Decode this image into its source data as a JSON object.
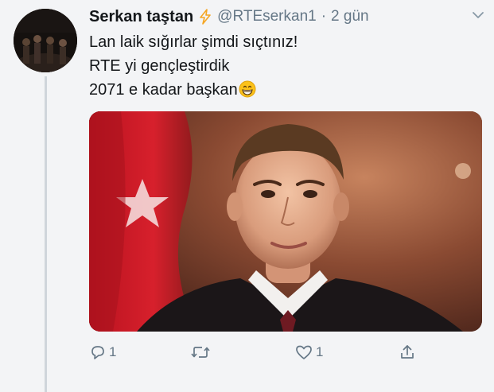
{
  "tweet": {
    "display_name": "Serkan taştan",
    "handle": "@RTEserkan1",
    "separator": "·",
    "time": "2 gün",
    "lines": [
      "Lan laik sığırlar şimdi sıçtınız!",
      "RTE yi gençleştirdik",
      "2071 e kadar başkan"
    ],
    "emoji": "grinning-face-emoji"
  },
  "actions": {
    "reply_count": "1",
    "retweet_count": "",
    "like_count": "1"
  },
  "icons": {
    "badge": "lightning-bolt-icon",
    "caret": "chevron-down-icon",
    "reply": "reply-icon",
    "retweet": "retweet-icon",
    "like": "heart-icon",
    "share": "share-icon"
  },
  "colors": {
    "text": "#14171a",
    "secondary": "#657786",
    "badge": "#f5a623",
    "flag_red": "#d0202e",
    "background": "#f3f4f6"
  }
}
